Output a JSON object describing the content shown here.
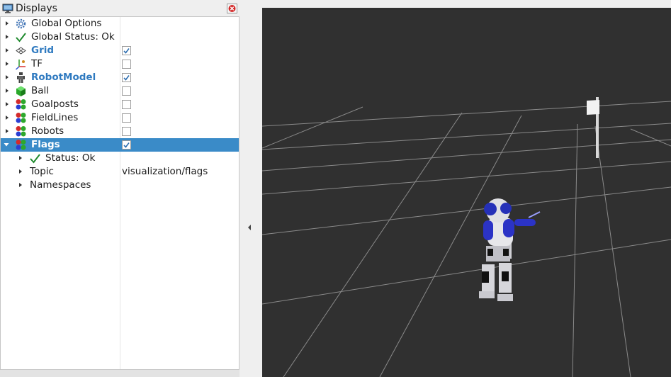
{
  "panel": {
    "title": "Displays",
    "icons": {
      "title": "monitor-icon",
      "close": "close-icon"
    }
  },
  "displays": [
    {
      "label": "Global Options",
      "icon": "gear-icon",
      "checked": null
    },
    {
      "label": "Global Status: Ok",
      "icon": "check-icon",
      "checked": null
    },
    {
      "label": "Grid",
      "icon": "grid-icon",
      "checked": true
    },
    {
      "label": "TF",
      "icon": "axes-icon",
      "checked": false
    },
    {
      "label": "RobotModel",
      "icon": "robot-icon",
      "checked": true
    },
    {
      "label": "Ball",
      "icon": "cube-icon",
      "checked": false
    },
    {
      "label": "Goalposts",
      "icon": "markers-icon",
      "checked": false
    },
    {
      "label": "FieldLines",
      "icon": "markers-icon",
      "checked": false
    },
    {
      "label": "Robots",
      "icon": "markers-icon",
      "checked": false
    },
    {
      "label": "Flags",
      "icon": "markers-icon",
      "checked": true,
      "selected": true,
      "expanded": true
    }
  ],
  "flags_children": [
    {
      "label": "Status: Ok",
      "icon": "check-icon"
    },
    {
      "label": "Topic",
      "value": "visualization/flags"
    },
    {
      "label": "Namespaces"
    }
  ],
  "colors": {
    "selection": "#3a8bc8",
    "enabled_label": "#2f7ac0",
    "viewport_bg": "#303030"
  }
}
